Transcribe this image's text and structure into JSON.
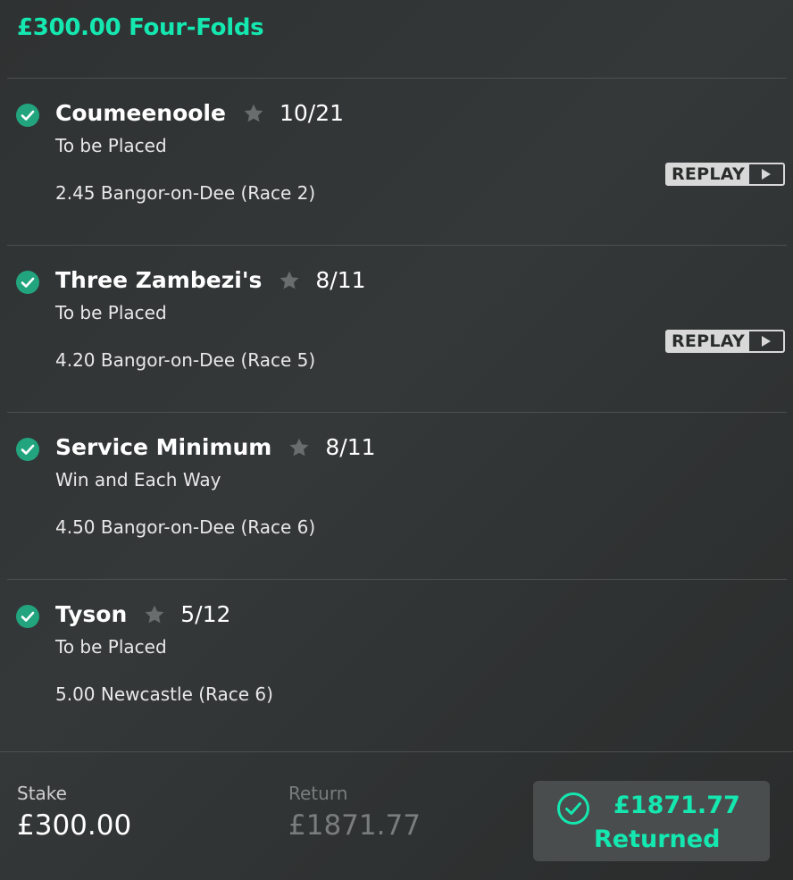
{
  "header": {
    "title": "£300.00 Four-Folds"
  },
  "selections": [
    {
      "runner": "Coumeenoole",
      "odds": "10/21",
      "market": "To be Placed",
      "event": "2.45 Bangor-on-Dee (Race 2)",
      "replay": "REPLAY"
    },
    {
      "runner": "Three Zambezi's",
      "odds": "8/11",
      "market": "To be Placed",
      "event": "4.20 Bangor-on-Dee (Race 5)",
      "replay": "REPLAY"
    },
    {
      "runner": "Service Minimum",
      "odds": "8/11",
      "market": "Win and Each Way",
      "event": "4.50 Bangor-on-Dee (Race 6)"
    },
    {
      "runner": "Tyson",
      "odds": "5/12",
      "market": "To be Placed",
      "event": "5.00 Newcastle (Race 6)"
    }
  ],
  "footer": {
    "stake_label": "Stake",
    "stake_value": "£300.00",
    "return_label": "Return",
    "return_value": "£1871.77",
    "returned_amount": "£1871.77",
    "returned_label": "Returned"
  },
  "colors": {
    "accent": "#14e8b0",
    "check": "#22a57f",
    "background": "#313434",
    "returned_box": "#4a4d4d"
  },
  "icons": {
    "check": "check-circle-icon",
    "favourite": "star-icon",
    "play": "play-icon"
  }
}
